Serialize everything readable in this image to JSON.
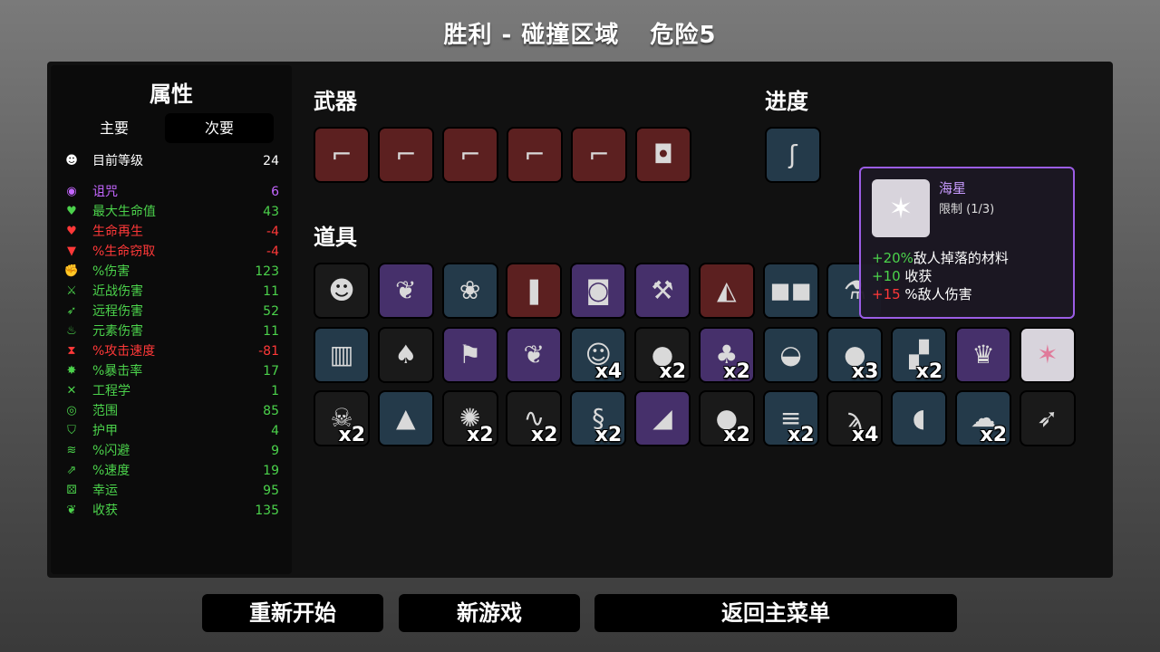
{
  "header": {
    "title": "胜利 - 碰撞区域",
    "danger": "危险5"
  },
  "stats": {
    "heading": "属性",
    "tabs": {
      "primary": "主要",
      "secondary": "次要"
    },
    "level": {
      "label": "目前等级",
      "value": "24"
    },
    "rows": [
      {
        "label": "诅咒",
        "value": "6",
        "color": "#c466ff",
        "icon": "eye-icon",
        "glyph": "◉"
      },
      {
        "label": "最大生命值",
        "value": "43",
        "color": "#4bd24b",
        "icon": "heart-icon",
        "glyph": "♥"
      },
      {
        "label": "生命再生",
        "value": "-4",
        "color": "#ff3838",
        "icon": "heart-plus-icon",
        "glyph": "♥"
      },
      {
        "label": "%生命窃取",
        "value": "-4",
        "color": "#ff3838",
        "icon": "fangs-icon",
        "glyph": "▼"
      },
      {
        "label": "%伤害",
        "value": "123",
        "color": "#4bd24b",
        "icon": "muscle-icon",
        "glyph": "✊"
      },
      {
        "label": "近战伤害",
        "value": "11",
        "color": "#4bd24b",
        "icon": "sword-icon",
        "glyph": "⚔"
      },
      {
        "label": "远程伤害",
        "value": "52",
        "color": "#4bd24b",
        "icon": "bow-icon",
        "glyph": "➶"
      },
      {
        "label": "元素伤害",
        "value": "11",
        "color": "#4bd24b",
        "icon": "flame-icon",
        "glyph": "♨"
      },
      {
        "label": "%攻击速度",
        "value": "-81",
        "color": "#ff3838",
        "icon": "hourglass-icon",
        "glyph": "⧗"
      },
      {
        "label": "%暴击率",
        "value": "17",
        "color": "#4bd24b",
        "icon": "crit-burst-icon",
        "glyph": "✸"
      },
      {
        "label": "工程学",
        "value": "1",
        "color": "#4bd24b",
        "icon": "wrench-icon",
        "glyph": "✕"
      },
      {
        "label": "范围",
        "value": "85",
        "color": "#4bd24b",
        "icon": "range-icon",
        "glyph": "◎"
      },
      {
        "label": "护甲",
        "value": "4",
        "color": "#4bd24b",
        "icon": "shield-icon",
        "glyph": "⛉"
      },
      {
        "label": "%闪避",
        "value": "9",
        "color": "#4bd24b",
        "icon": "dodge-icon",
        "glyph": "≋"
      },
      {
        "label": "%速度",
        "value": "19",
        "color": "#4bd24b",
        "icon": "boot-icon",
        "glyph": "⇗"
      },
      {
        "label": "幸运",
        "value": "95",
        "color": "#4bd24b",
        "icon": "dice-icon",
        "glyph": "⚄"
      },
      {
        "label": "收获",
        "value": "135",
        "color": "#4bd24b",
        "icon": "wheat-icon",
        "glyph": "❦"
      }
    ]
  },
  "weapons": {
    "heading": "武器",
    "items": [
      {
        "name": "laser-gun-icon",
        "tier": "red",
        "glyph": "⌐"
      },
      {
        "name": "laser-gun-icon",
        "tier": "red",
        "glyph": "⌐"
      },
      {
        "name": "laser-gun-icon",
        "tier": "red",
        "glyph": "⌐"
      },
      {
        "name": "laser-gun-icon",
        "tier": "red",
        "glyph": "⌐"
      },
      {
        "name": "laser-gun-icon",
        "tier": "red",
        "glyph": "⌐"
      },
      {
        "name": "minigun-camera-icon",
        "tier": "red",
        "glyph": "◘"
      }
    ]
  },
  "progress": {
    "heading": "进度",
    "items": [
      {
        "name": "tentacle-icon",
        "tier": "blue",
        "glyph": "ʃ"
      }
    ]
  },
  "items": {
    "heading": "道具",
    "rows": [
      [
        {
          "name": "eyepatch-cookie-icon",
          "tier": "black",
          "glyph": "☻",
          "qty": ""
        },
        {
          "name": "wheat-icon",
          "tier": "purple",
          "glyph": "❦",
          "qty": ""
        },
        {
          "name": "alien-rubble-icon",
          "tier": "blue",
          "glyph": "❀",
          "qty": ""
        },
        {
          "name": "bullet-icon",
          "tier": "red",
          "glyph": "❚",
          "qty": ""
        },
        {
          "name": "bucket-icon",
          "tier": "purple",
          "glyph": "◙",
          "qty": ""
        },
        {
          "name": "tools-icon",
          "tier": "purple",
          "glyph": "⚒",
          "qty": ""
        },
        {
          "name": "wolf-head-icon",
          "tier": "red",
          "glyph": "◭",
          "qty": ""
        },
        {
          "name": "glasses-icon",
          "tier": "blue",
          "glyph": "◼◼",
          "qty": ""
        },
        {
          "name": "potion-icon",
          "tier": "blue",
          "glyph": "⚗",
          "qty": ""
        }
      ],
      [
        {
          "name": "metal-cylinder-icon",
          "tier": "blue",
          "glyph": "▥",
          "qty": ""
        },
        {
          "name": "mushroom-icon",
          "tier": "black",
          "glyph": "♠",
          "qty": ""
        },
        {
          "name": "axe-icon",
          "tier": "purple",
          "glyph": "⚑",
          "qty": ""
        },
        {
          "name": "wings-icon",
          "tier": "purple",
          "glyph": "❦",
          "qty": ""
        },
        {
          "name": "frog-icon",
          "tier": "blue",
          "glyph": "☺",
          "qty": "x4"
        },
        {
          "name": "bandage-ball-icon",
          "tier": "black",
          "glyph": "●",
          "qty": "x2"
        },
        {
          "name": "clover-icon",
          "tier": "purple",
          "glyph": "♣",
          "qty": "x2"
        },
        {
          "name": "cauldron-icon",
          "tier": "blue",
          "glyph": "◒",
          "qty": ""
        },
        {
          "name": "pumpkin-icon",
          "tier": "blue",
          "glyph": "●",
          "qty": "x3"
        },
        {
          "name": "cape-icon",
          "tier": "blue",
          "glyph": "▞",
          "qty": "x2"
        },
        {
          "name": "golden-idol-icon",
          "tier": "purple",
          "glyph": "♛",
          "qty": ""
        },
        {
          "name": "starfish-icon",
          "tier": "white",
          "glyph": "✶",
          "qty": ""
        }
      ],
      [
        {
          "name": "ghost-icon",
          "tier": "black",
          "glyph": "☠",
          "qty": "x2"
        },
        {
          "name": "rocket-icon",
          "tier": "blue",
          "glyph": "▲",
          "qty": ""
        },
        {
          "name": "hedgehog-icon",
          "tier": "black",
          "glyph": "✺",
          "qty": "x2"
        },
        {
          "name": "lizard-icon",
          "tier": "black",
          "glyph": "∿",
          "qty": "x2"
        },
        {
          "name": "worm-icon",
          "tier": "blue",
          "glyph": "§",
          "qty": "x2"
        },
        {
          "name": "prism-icon",
          "tier": "purple",
          "glyph": "◢",
          "qty": ""
        },
        {
          "name": "snowball-icon",
          "tier": "black",
          "glyph": "●",
          "qty": "x2"
        },
        {
          "name": "claw-scarf-icon",
          "tier": "blue",
          "glyph": "≡",
          "qty": "x2"
        },
        {
          "name": "tongue-icon",
          "tier": "black",
          "glyph": "ϡ",
          "qty": "x4"
        },
        {
          "name": "flashlight-icon",
          "tier": "blue",
          "glyph": "◖",
          "qty": ""
        },
        {
          "name": "sponge-icon",
          "tier": "blue",
          "glyph": "☁",
          "qty": "x2"
        },
        {
          "name": "feather-icon",
          "tier": "black",
          "glyph": "➶",
          "qty": ""
        }
      ]
    ]
  },
  "tooltip": {
    "name": "海星",
    "limit": "限制 (1/3)",
    "lines": [
      {
        "value": "+20%",
        "text": "敌人掉落的材料",
        "color": "#4bd24b"
      },
      {
        "value": "+10",
        "text": " 收获",
        "color": "#4bd24b"
      },
      {
        "value": "+15",
        "text": " %敌人伤害",
        "color": "#ff3838"
      }
    ]
  },
  "buttons": {
    "restart": "重新开始",
    "new_game": "新游戏",
    "main_menu": "返回主菜单"
  },
  "tier_colors": {
    "red": "#5c2020",
    "purple": "#46306b",
    "blue": "#243a4a",
    "black": "#1a1a1a",
    "white": "#d8d4dc"
  }
}
